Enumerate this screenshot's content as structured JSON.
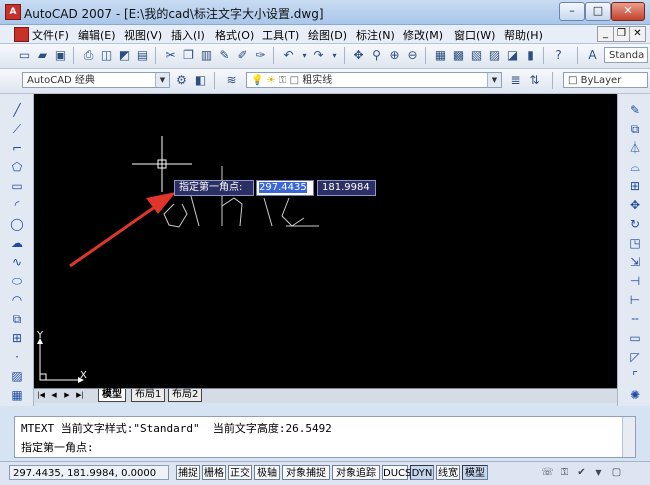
{
  "window": {
    "title": "AutoCAD 2007 - [E:\\我的cad\\标注文字大小设置.dwg]",
    "minimize": "–",
    "maximize": "□",
    "close": "✕"
  },
  "menu": {
    "items": [
      "文件(F)",
      "编辑(E)",
      "视图(V)",
      "插入(I)",
      "格式(O)",
      "工具(T)",
      "绘图(D)",
      "标注(N)",
      "修改(M)",
      "窗口(W)",
      "帮助(H)"
    ],
    "doc_minimize": "_",
    "doc_restore": "❐",
    "doc_close": "✕"
  },
  "toolbar1": {
    "text_style_combo": "Standa"
  },
  "toolbar2": {
    "workspace_combo": "AutoCAD 经典",
    "layer_combo": "粗实线",
    "color_combo": "ByLayer"
  },
  "canvas": {
    "background": "#000000",
    "dynamic_input": {
      "prompt": "指定第一角点:",
      "x_value": "297.4435",
      "y_value": "181.9984"
    },
    "ucs": {
      "x_label": "X",
      "y_label": "Y"
    },
    "annotation_color": "#e0352b"
  },
  "tabs": {
    "items": [
      "模型",
      "布局1",
      "布局2"
    ],
    "active": "模型"
  },
  "command": {
    "history_line": "MTEXT 当前文字样式:\"Standard\"  当前文字高度:26.5492",
    "prompt_line": "指定第一角点:"
  },
  "statusbar": {
    "coordinates": "297.4435, 181.9984, 0.0000",
    "toggles": [
      {
        "label": "捕捉",
        "on": false
      },
      {
        "label": "栅格",
        "on": false
      },
      {
        "label": "正交",
        "on": false
      },
      {
        "label": "极轴",
        "on": false
      },
      {
        "label": "对象捕捉",
        "on": false
      },
      {
        "label": "对象追踪",
        "on": false
      },
      {
        "label": "DUCS",
        "on": false
      },
      {
        "label": "DYN",
        "on": true
      },
      {
        "label": "线宽",
        "on": false
      },
      {
        "label": "模型",
        "on": true
      }
    ]
  },
  "icons": {
    "draw_tools": [
      "line-icon",
      "construction-line-icon",
      "polyline-icon",
      "polygon-icon",
      "rectangle-icon",
      "arc-icon",
      "circle-icon",
      "revision-cloud-icon",
      "spline-icon",
      "ellipse-icon",
      "ellipse-arc-icon",
      "insert-block-icon",
      "make-block-icon",
      "point-icon",
      "hatch-icon",
      "table-icon"
    ],
    "modify_tools": [
      "erase-icon",
      "copy-icon",
      "mirror-icon",
      "offset-icon",
      "array-icon",
      "move-icon",
      "rotate-icon",
      "scale-icon",
      "stretch-icon",
      "trim-icon",
      "extend-icon",
      "break-icon",
      "join-icon",
      "chamfer-icon",
      "fillet-icon",
      "explode-icon"
    ]
  }
}
